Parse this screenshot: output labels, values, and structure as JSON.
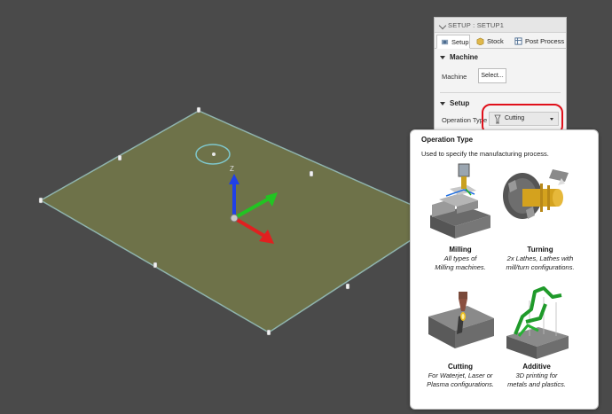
{
  "panel": {
    "title": "SETUP : SETUP1",
    "tabs": [
      {
        "label": "Setup",
        "icon": "setup-icon"
      },
      {
        "label": "Stock",
        "icon": "stock-box-icon"
      },
      {
        "label": "Post Process",
        "icon": "post-process-icon"
      }
    ],
    "machine_section": {
      "header": "Machine",
      "label": "Machine",
      "button": "Select..."
    },
    "setup_section": {
      "header": "Setup",
      "operation_type_label": "Operation Type",
      "operation_type_value": "Cutting"
    }
  },
  "tooltip": {
    "title": "Operation Type",
    "description": "Used to specify the manufacturing process.",
    "options": [
      {
        "name": "Milling",
        "desc_line1": "All types of",
        "desc_line2": "Milling machines."
      },
      {
        "name": "Turning",
        "desc_line1": "2x Lathes, Lathes with",
        "desc_line2": "mill/turn configurations."
      },
      {
        "name": "Cutting",
        "desc_line1": "For Waterjet, Laser or",
        "desc_line2": "Plasma configurations."
      },
      {
        "name": "Additive",
        "desc_line1": "3D printing for",
        "desc_line2": "metals and plastics."
      }
    ]
  },
  "viewport": {
    "stock_color": "#6e7249",
    "background_color": "#4a4a4a",
    "axes": {
      "x_color": "#e02020",
      "y_color": "#22c422",
      "z_color": "#2040e8",
      "z_label": "Z"
    }
  },
  "colors": {
    "highlight": "#e0101a"
  }
}
